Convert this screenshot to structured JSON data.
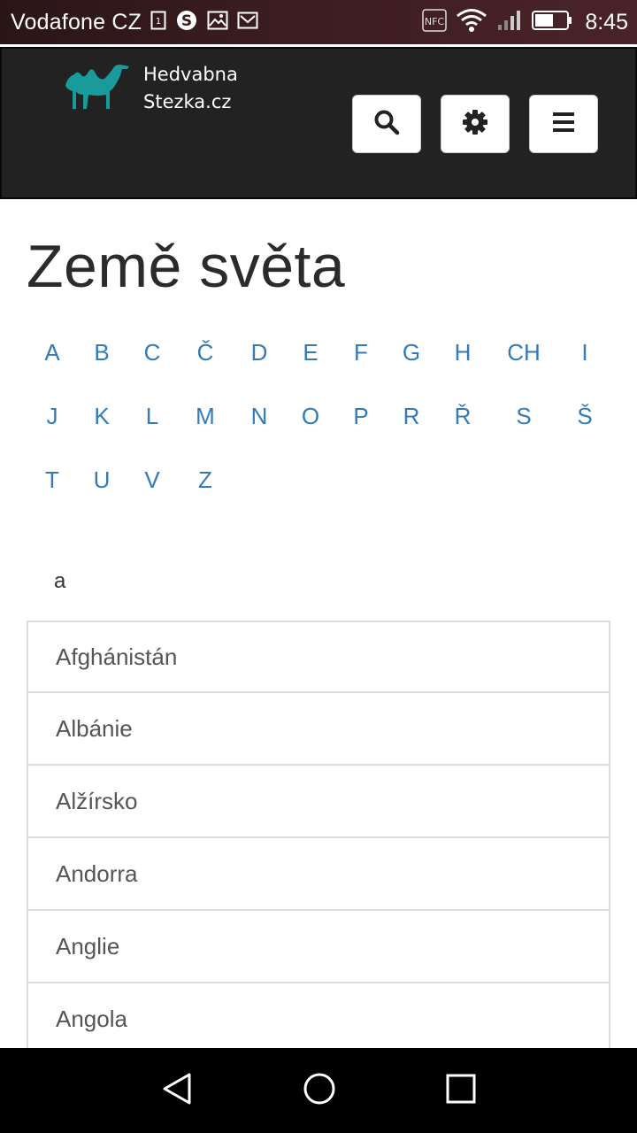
{
  "status_bar": {
    "carrier": "Vodafone CZ",
    "nfc_label": "NFC",
    "time": "8:45",
    "icons": [
      "sim-icon",
      "skype-icon",
      "image-icon",
      "gmail-icon",
      "nfc-icon",
      "wifi-icon",
      "signal-icon",
      "battery-icon"
    ]
  },
  "header": {
    "logo_line1": "Hedvabna",
    "logo_line2": "Stezka.cz",
    "logo_color": "#1a9b9b",
    "buttons": [
      "search-icon",
      "gear-icon",
      "menu-icon"
    ]
  },
  "page": {
    "title": "Země světa",
    "alphabet": [
      "A",
      "B",
      "C",
      "Č",
      "D",
      "E",
      "F",
      "G",
      "H",
      "CH",
      "I",
      "J",
      "K",
      "L",
      "M",
      "N",
      "O",
      "P",
      "R",
      "Ř",
      "S",
      "Š",
      "T",
      "U",
      "V",
      "Z"
    ],
    "section_letter": "a",
    "countries": [
      "Afghánistán",
      "Albánie",
      "Alžírsko",
      "Andorra",
      "Anglie",
      "Angola"
    ]
  },
  "colors": {
    "link": "#337ab7",
    "header_bg": "#222222",
    "text": "#2b2b2b"
  },
  "nav_bar": {
    "buttons": [
      "back-icon",
      "home-icon",
      "recents-icon"
    ]
  }
}
